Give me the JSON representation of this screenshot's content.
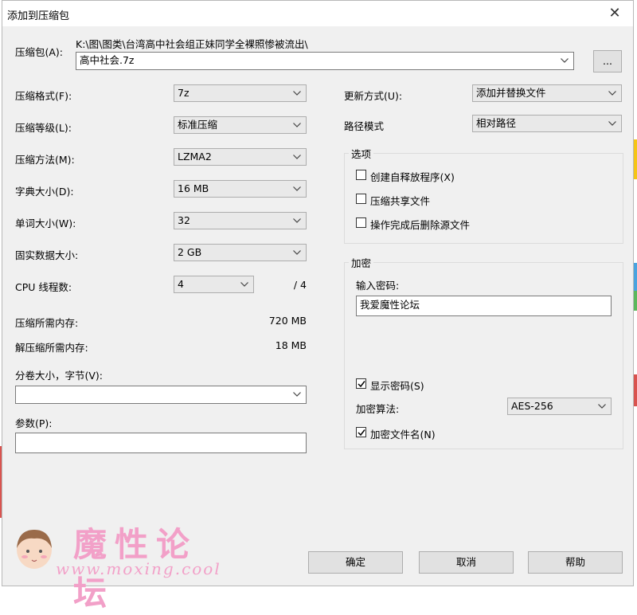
{
  "window": {
    "title": "添加到压缩包",
    "close_glyph": "✕"
  },
  "archive": {
    "label": "压缩包(A):",
    "path": "K:\\图\\图类\\台湾高中社会组正妹同学全裸照惨被流出\\",
    "name": "高中社会.7z",
    "browse_label": "..."
  },
  "left_options": {
    "format": {
      "label": "压缩格式(F):",
      "value": "7z"
    },
    "level": {
      "label": "压缩等级(L):",
      "value": "标准压缩"
    },
    "method": {
      "label": "压缩方法(M):",
      "value": "LZMA2"
    },
    "dict": {
      "label": "字典大小(D):",
      "value": "16 MB"
    },
    "word": {
      "label": "单词大小(W):",
      "value": "32"
    },
    "solid": {
      "label": "固实数据大小:",
      "value": "2 GB"
    },
    "threads": {
      "label": "CPU 线程数:",
      "value": "4",
      "max": "/ 4"
    },
    "mem_compress": {
      "label": "压缩所需内存:",
      "value": "720 MB"
    },
    "mem_decompress": {
      "label": "解压缩所需内存:",
      "value": "18 MB"
    },
    "split": {
      "label": "分卷大小，字节(V):",
      "value": ""
    },
    "params": {
      "label": "参数(P):",
      "value": ""
    }
  },
  "right_options": {
    "update": {
      "label": "更新方式(U):",
      "value": "添加并替换文件"
    },
    "pathmode": {
      "label": "路径模式",
      "value": "相对路径"
    },
    "options_group": {
      "title": "选项",
      "sfx": "创建自释放程序(X)",
      "shared": "压缩共享文件",
      "delete": "操作完成后删除源文件"
    },
    "encryption": {
      "title": "加密",
      "password_label": "输入密码:",
      "password_value": "我爱魔性论坛",
      "show_password": "显示密码(S)",
      "method_label": "加密算法:",
      "method_value": "AES-256",
      "encrypt_names": "加密文件名(N)"
    }
  },
  "buttons": {
    "ok": "确定",
    "cancel": "取消",
    "help": "帮助"
  },
  "watermark": {
    "text": "魔性论坛",
    "url": "www.moxing.cool"
  },
  "colors": {
    "dialog_bg": "#f0f0f0",
    "watermark_pink": "#f2a0c8"
  }
}
